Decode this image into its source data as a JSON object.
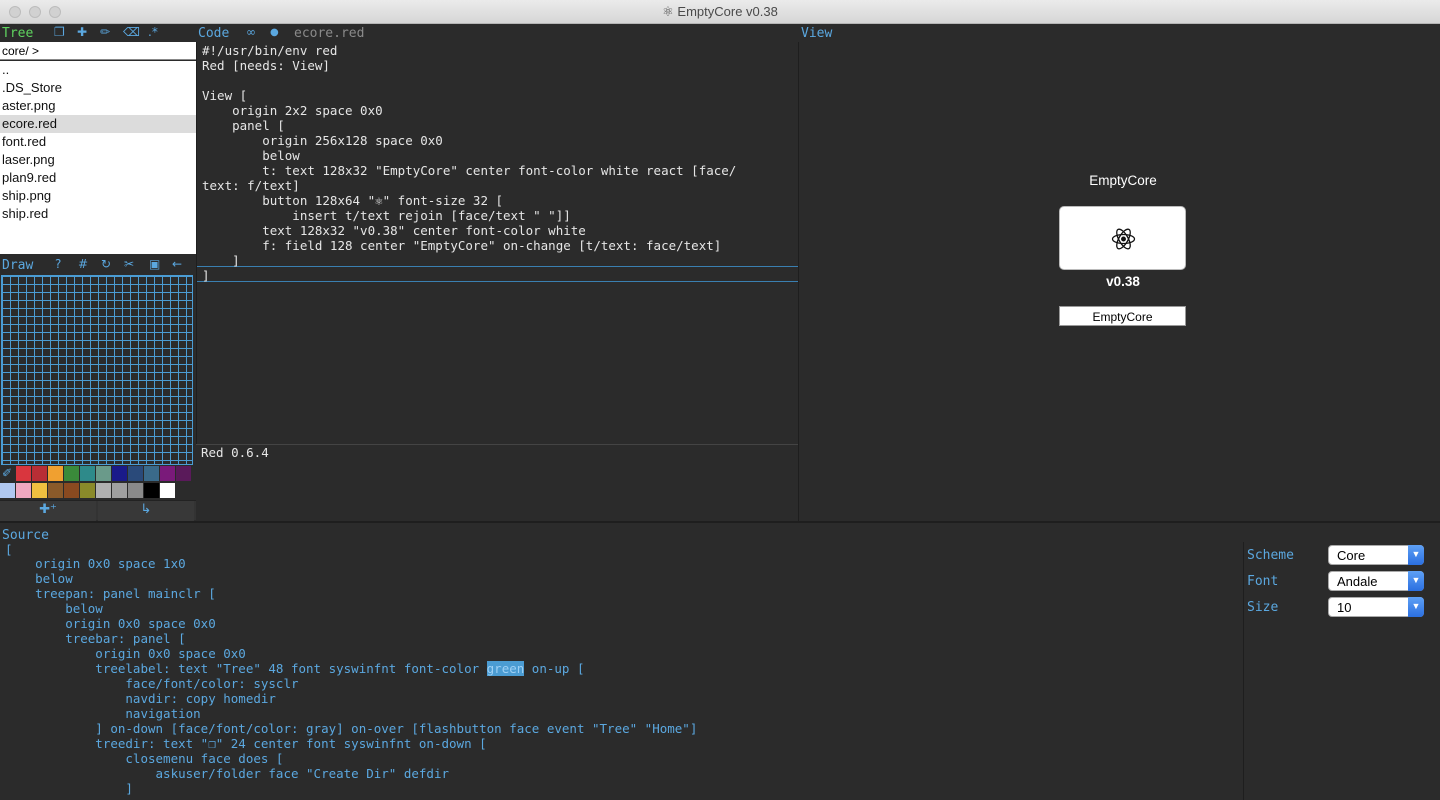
{
  "window": {
    "title": "⚛ EmptyCore v0.38"
  },
  "tree": {
    "label": "Tree",
    "icons": [
      "❐",
      "✚",
      "✏",
      "⌫",
      ".*"
    ],
    "path": "core/ >",
    "items": [
      "..",
      ".DS_Store",
      "aster.png",
      "ecore.red",
      "font.red",
      "laser.png",
      "plan9.red",
      "ship.png",
      "ship.red"
    ],
    "selected": "ecore.red"
  },
  "draw": {
    "label": "Draw",
    "icons": [
      "?",
      "#",
      "↻",
      "✂",
      "▣",
      "←"
    ],
    "palette_row1": [
      "#d9363e",
      "#b82e35",
      "#f0a030",
      "#3a8a3a",
      "#2e8a8a",
      "#6a9a8a",
      "#1a1a8a",
      "#2a4a7a",
      "#3a6a8a",
      "#7a1a7a",
      "#5a1a5a"
    ],
    "palette_row2": [
      "#b0c8f0",
      "#f0a8c0",
      "#f0c040",
      "#8a5a2a",
      "#8a4a20",
      "#8a8a2a",
      "#b0b0b0",
      "#a0a0a0",
      "#8a8a8a",
      "#000000",
      "#ffffff"
    ],
    "footer": [
      "✚⁺",
      "↳"
    ]
  },
  "code": {
    "label": "Code",
    "link_icon": "∞",
    "dot_icon": "●",
    "filename": "ecore.red",
    "lines": [
      "#!/usr/bin/env red",
      "Red [needs: View]",
      "",
      "View [",
      "    origin 2x2 space 0x0",
      "    panel [",
      "        origin 256x128 space 0x0",
      "        below",
      "        t: text 128x32 \"EmptyCore\" center font-color white react [face/",
      "text: f/text]",
      "        button 128x64 \"⚛\" font-size 32 [",
      "            insert t/text rejoin [face/text \" \"]]",
      "        text 128x32 \"v0.38\" center font-color white",
      "        f: field 128 center \"EmptyCore\" on-change [t/text: face/text]",
      "    ]",
      "]"
    ],
    "console": "Red 0.6.4"
  },
  "view": {
    "label": "View",
    "preview_title": "EmptyCore",
    "preview_button": "⚛",
    "preview_version": "v0.38",
    "preview_field": "EmptyCore"
  },
  "source": {
    "label": "Source",
    "lines": [
      "[",
      "    origin 0x0 space 1x0",
      "    below",
      "    treepan: panel mainclr [",
      "        below",
      "        origin 0x0 space 0x0",
      "        treebar: panel [",
      "            origin 0x0 space 0x0",
      "            treelabel: text \"Tree\" 48 font syswinfnt font-color ",
      "                face/font/color: sysclr",
      "                navdir: copy homedir",
      "                navigation",
      "            ] on-down [face/font/color: gray] on-over [flashbutton face event \"Tree\" \"Home\"]",
      "            treedir: text \"❐\" 24 center font syswinfnt on-down [",
      "                closemenu face does [",
      "                    askuser/folder face \"Create Dir\" defdir",
      "                ]"
    ],
    "highlight_word": "green",
    "after_highlight": " on-up ["
  },
  "settings": {
    "scheme_label": "Scheme",
    "scheme_value": "Core",
    "font_label": "Font",
    "font_value": "Andale",
    "size_label": "Size",
    "size_value": "10"
  },
  "colors": {
    "accent": "#5ba8e0",
    "tree_label": "#5fd35f",
    "background": "#2b2b2b"
  }
}
